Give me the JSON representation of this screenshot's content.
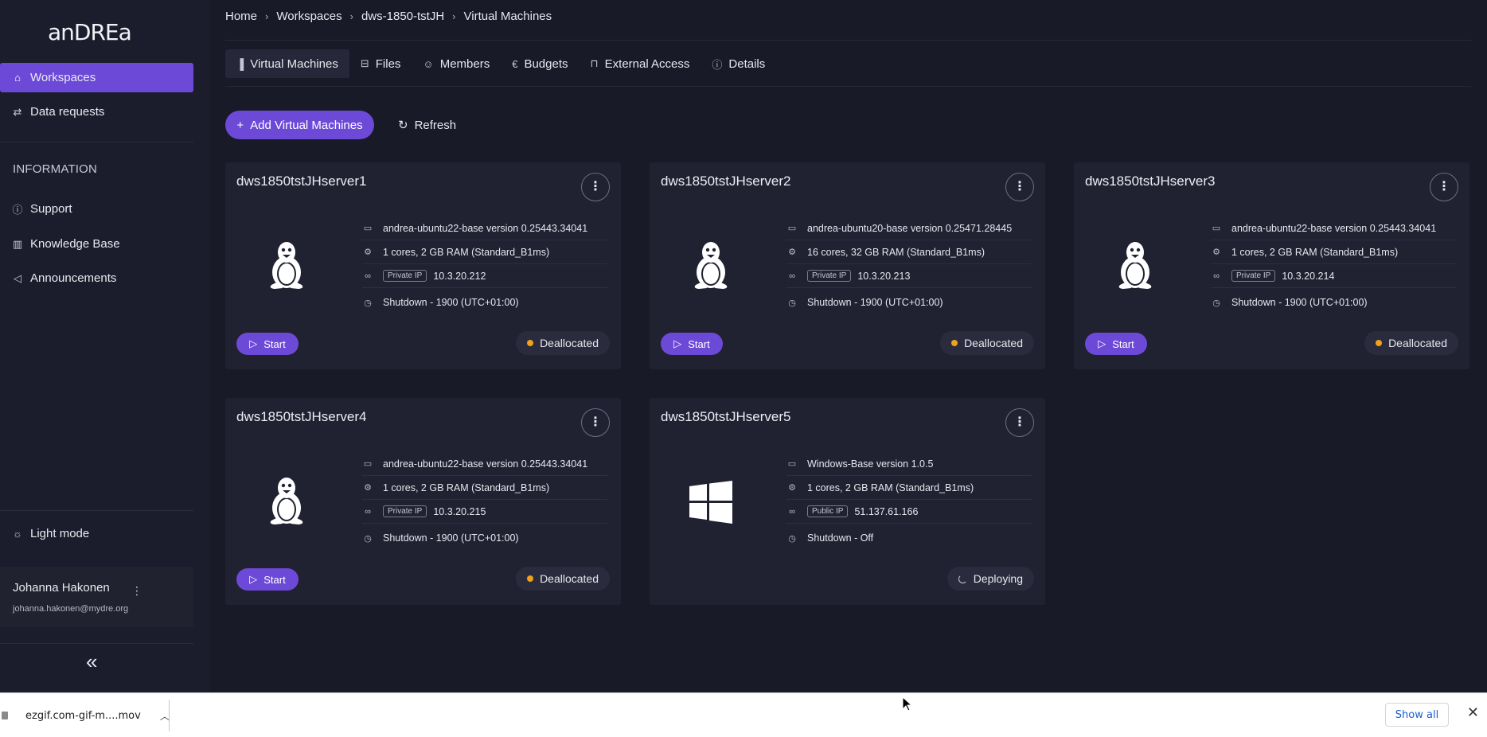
{
  "app": {
    "logo": "anDREa"
  },
  "sidebar": {
    "items": [
      {
        "label": "Workspaces",
        "icon": "home-icon",
        "active": true
      },
      {
        "label": "Data requests",
        "icon": "arrows-swap-icon"
      }
    ],
    "info_label": "INFORMATION",
    "info_items": [
      {
        "label": "Support",
        "icon": "info-circle-icon"
      },
      {
        "label": "Knowledge Base",
        "icon": "book-icon"
      },
      {
        "label": "Announcements",
        "icon": "megaphone-icon"
      }
    ],
    "light_mode": "Light mode",
    "user": {
      "name": "Johanna Hakonen",
      "email": "johanna.hakonen@mydre.org"
    }
  },
  "breadcrumb": [
    "Home",
    "Workspaces",
    "dws-1850-tstJH",
    "Virtual Machines"
  ],
  "tabs": [
    {
      "label": "Virtual Machines",
      "icon": "bar-chart-icon",
      "active": true
    },
    {
      "label": "Files",
      "icon": "storage-icon"
    },
    {
      "label": "Members",
      "icon": "users-icon"
    },
    {
      "label": "Budgets",
      "icon": "euro-icon"
    },
    {
      "label": "External Access",
      "icon": "lock-icon"
    },
    {
      "label": "Details",
      "icon": "info-icon"
    }
  ],
  "actions": {
    "add": "Add Virtual Machines",
    "refresh": "Refresh"
  },
  "vms": [
    {
      "name": "dws1850tstJHserver1",
      "os": "linux",
      "image": "andrea-ubuntu22-base version 0.25443.34041",
      "size": "1 cores, 2 GB RAM (Standard_B1ms)",
      "ip_type": "Private IP",
      "ip": "10.3.20.212",
      "shutdown": "Shutdown -  1900  (UTC+01:00)",
      "start": "Start",
      "status": "Deallocated"
    },
    {
      "name": "dws1850tstJHserver2",
      "os": "linux",
      "image": "andrea-ubuntu20-base version 0.25471.28445",
      "size": "16 cores, 32 GB RAM (Standard_B1ms)",
      "ip_type": "Private IP",
      "ip": "10.3.20.213",
      "shutdown": "Shutdown -  1900  (UTC+01:00)",
      "start": "Start",
      "status": "Deallocated"
    },
    {
      "name": "dws1850tstJHserver3",
      "os": "linux",
      "image": "andrea-ubuntu22-base version 0.25443.34041",
      "size": "1 cores, 2 GB RAM (Standard_B1ms)",
      "ip_type": "Private IP",
      "ip": "10.3.20.214",
      "shutdown": "Shutdown -  1900  (UTC+01:00)",
      "start": "Start",
      "status": "Deallocated"
    },
    {
      "name": "dws1850tstJHserver4",
      "os": "linux",
      "image": "andrea-ubuntu22-base version 0.25443.34041",
      "size": "1 cores, 2 GB RAM (Standard_B1ms)",
      "ip_type": "Private IP",
      "ip": "10.3.20.215",
      "shutdown": "Shutdown -  1900  (UTC+01:00)",
      "start": "Start",
      "status": "Deallocated"
    },
    {
      "name": "dws1850tstJHserver5",
      "os": "windows",
      "image": "Windows-Base version 1.0.5",
      "size": "1 cores, 2 GB RAM (Standard_B1ms)",
      "ip_type": "Public IP",
      "ip": "51.137.61.166",
      "shutdown": "Shutdown -  Off",
      "start": "",
      "status": "Deploying"
    }
  ],
  "download_bar": {
    "file": "ezgif.com-gif-m....mov",
    "show_all": "Show all"
  },
  "colors": {
    "accent": "#6d49d8",
    "background": "#181a28",
    "card": "#202232",
    "status_dot": "#f0a21a"
  }
}
